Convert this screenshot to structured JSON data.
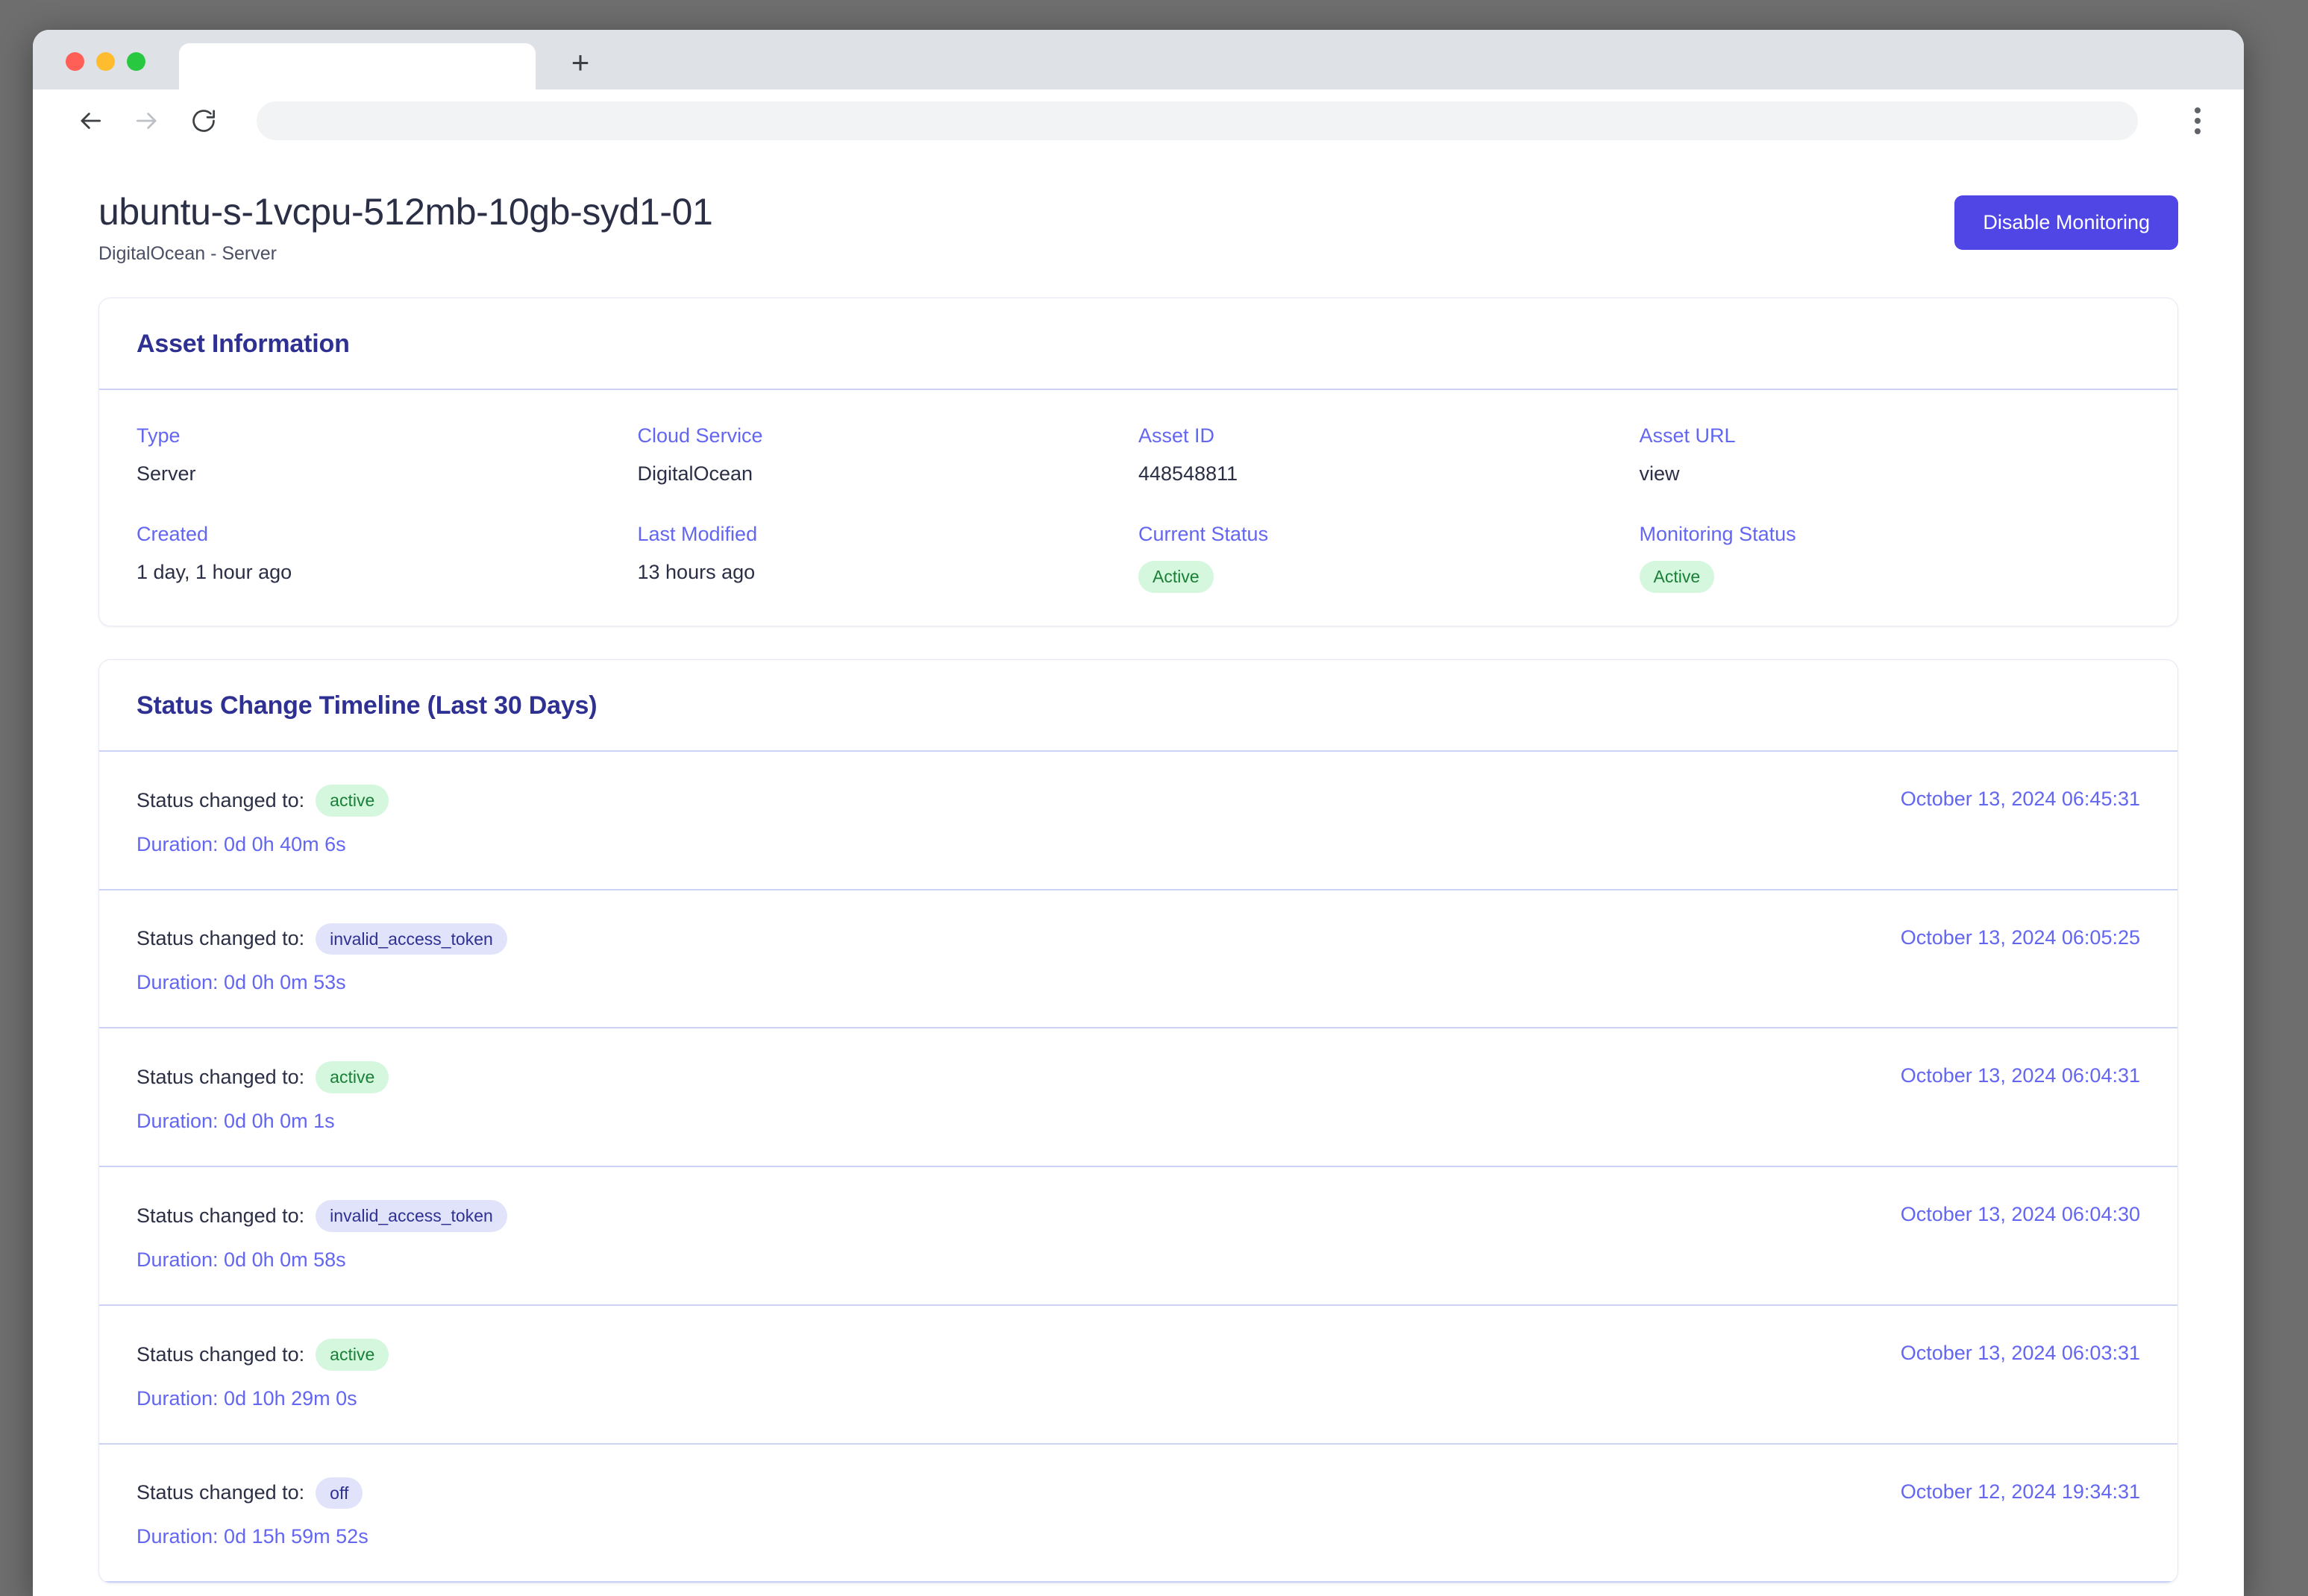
{
  "browser": {
    "tab_title": "",
    "url": "",
    "back_icon": "back-arrow-icon",
    "forward_icon": "forward-arrow-icon",
    "reload_icon": "reload-icon",
    "new_tab_label": "+",
    "menu_icon": "kebab-menu-icon"
  },
  "header": {
    "title": "ubuntu-s-1vcpu-512mb-10gb-syd1-01",
    "subtitle": "DigitalOcean - Server",
    "action_label": "Disable Monitoring"
  },
  "asset_card": {
    "title": "Asset Information",
    "fields": [
      {
        "label": "Type",
        "value": "Server"
      },
      {
        "label": "Cloud Service",
        "value": "DigitalOcean"
      },
      {
        "label": "Asset ID",
        "value": "448548811"
      },
      {
        "label": "Asset URL",
        "value": "view"
      },
      {
        "label": "Created",
        "value": "1 day, 1 hour ago"
      },
      {
        "label": "Last Modified",
        "value": "13 hours ago"
      },
      {
        "label": "Current Status",
        "value": "Active"
      },
      {
        "label": "Monitoring Status",
        "value": "Active"
      }
    ]
  },
  "timeline_card": {
    "title": "Status Change Timeline (Last 30 Days)",
    "row_prefix": "Status changed to:",
    "rows": [
      {
        "status": "active",
        "status_kind": "green",
        "duration": "Duration: 0d 0h 40m 6s",
        "timestamp": "October 13, 2024 06:45:31"
      },
      {
        "status": "invalid_access_token",
        "status_kind": "indigo",
        "duration": "Duration: 0d 0h 0m 53s",
        "timestamp": "October 13, 2024 06:05:25"
      },
      {
        "status": "active",
        "status_kind": "green",
        "duration": "Duration: 0d 0h 0m 1s",
        "timestamp": "October 13, 2024 06:04:31"
      },
      {
        "status": "invalid_access_token",
        "status_kind": "indigo",
        "duration": "Duration: 0d 0h 0m 58s",
        "timestamp": "October 13, 2024 06:04:30"
      },
      {
        "status": "active",
        "status_kind": "green",
        "duration": "Duration: 0d 10h 29m 0s",
        "timestamp": "October 13, 2024 06:03:31"
      },
      {
        "status": "off",
        "status_kind": "indigo",
        "duration": "Duration: 0d 15h 59m 52s",
        "timestamp": "October 12, 2024 19:34:31"
      }
    ]
  },
  "colors": {
    "accent": "#4f46e5",
    "title": "#2e3192",
    "label": "#6366f1",
    "badge_green_bg": "#d4f7dd",
    "badge_green_fg": "#1a7f37",
    "badge_indigo_bg": "#e1e3fb",
    "badge_indigo_fg": "#2e3192",
    "divider": "#ccd2f5"
  }
}
